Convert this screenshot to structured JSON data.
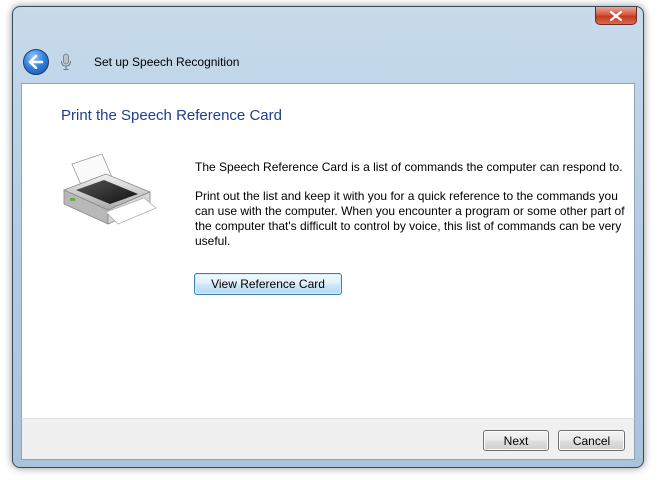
{
  "window": {
    "title": "Set up Speech Recognition",
    "close_icon": "close-icon",
    "back_icon": "back-arrow-icon",
    "app_icon": "microphone-icon"
  },
  "main": {
    "heading": "Print the Speech Reference Card",
    "illustration": "printer-icon",
    "paragraph_1": "The Speech Reference Card is a list of commands the computer can respond to.",
    "paragraph_2": "Print out the list and keep it with you for a quick reference to the commands you can use with the computer. When you encounter a program or some other part of the computer that's difficult to control by voice, this list of commands can be very useful.",
    "view_button_label": "View Reference Card"
  },
  "footer": {
    "next_label": "Next",
    "cancel_label": "Cancel"
  },
  "colors": {
    "heading": "#1e3f8c",
    "frame": "#b5cde2",
    "close_button": "#c23a20"
  }
}
